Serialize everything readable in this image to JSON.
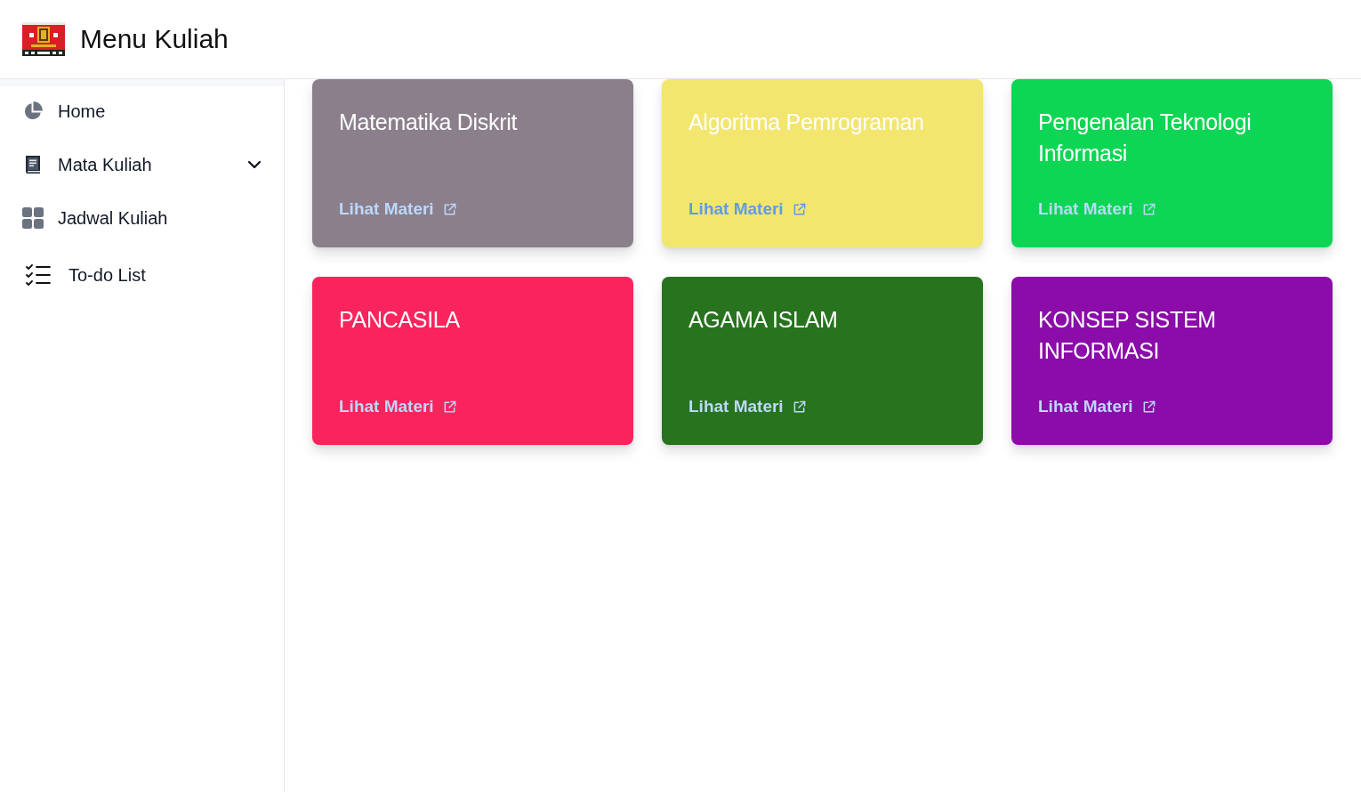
{
  "header": {
    "title": "Menu Kuliah"
  },
  "sidebar": {
    "items": [
      {
        "label": "Home"
      },
      {
        "label": "Mata Kuliah",
        "expanded": false
      },
      {
        "label": "Jadwal Kuliah"
      },
      {
        "label": "To-do List"
      }
    ]
  },
  "cards": [
    {
      "title": "Matematika Diskrit",
      "link": "Lihat Materi",
      "color": "#8b7f8b"
    },
    {
      "title": "Algoritma Pemrograman",
      "link": "Lihat Materi",
      "color": "#f2e66f"
    },
    {
      "title": "Pengenalan Teknologi Informasi",
      "link": "Lihat Materi",
      "color": "#0dd654"
    },
    {
      "title": "PANCASILA",
      "link": "Lihat Materi",
      "color": "#f9245c"
    },
    {
      "title": "AGAMA ISLAM",
      "link": "Lihat Materi",
      "color": "#27731e"
    },
    {
      "title": "KONSEP SISTEM INFORMASI",
      "link": "Lihat Materi",
      "color": "#8b0ca9"
    }
  ]
}
